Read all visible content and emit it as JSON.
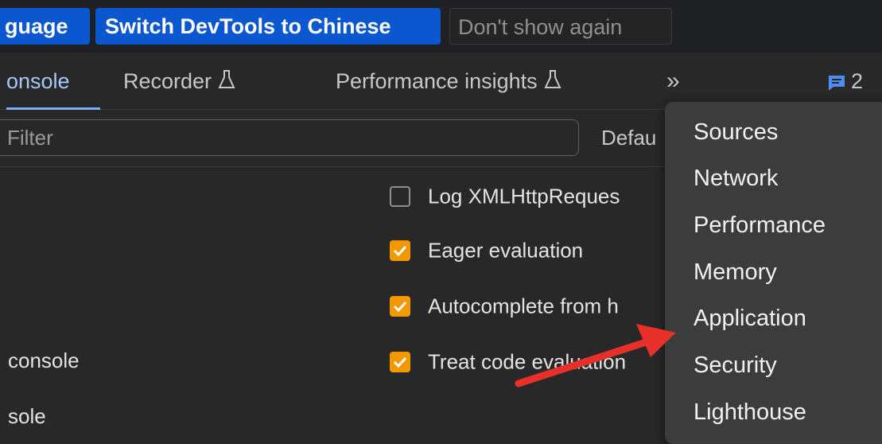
{
  "language_bar": {
    "language_label": "guage",
    "switch_label": "Switch DevTools to Chinese",
    "dont_show_label": "Don't show again"
  },
  "tabs": [
    {
      "label": "onsole",
      "active": true
    },
    {
      "label": "Recorder",
      "icon": "flask-icon"
    },
    {
      "label": "Performance insights",
      "icon": "flask-icon"
    }
  ],
  "more_tabs_icon": "chevron-double-right-icon",
  "issues": {
    "icon": "message-icon",
    "count": "2",
    "color": "#4c8df6"
  },
  "filter": {
    "placeholder": "Filter",
    "levels_label": "Defau"
  },
  "left_labels": [
    "console",
    "sole"
  ],
  "settings": [
    {
      "label": "Log XMLHttpReques",
      "checked": false
    },
    {
      "label": "Eager evaluation",
      "checked": true
    },
    {
      "label": "Autocomplete from h",
      "checked": true
    },
    {
      "label": "Treat code evaluation",
      "checked": true
    }
  ],
  "more_menu": [
    "Sources",
    "Network",
    "Performance",
    "Memory",
    "Application",
    "Security",
    "Lighthouse"
  ],
  "colors": {
    "accent": "#0b57d0",
    "checkbox": "#f29900",
    "annotation_arrow": "#e8302a"
  }
}
